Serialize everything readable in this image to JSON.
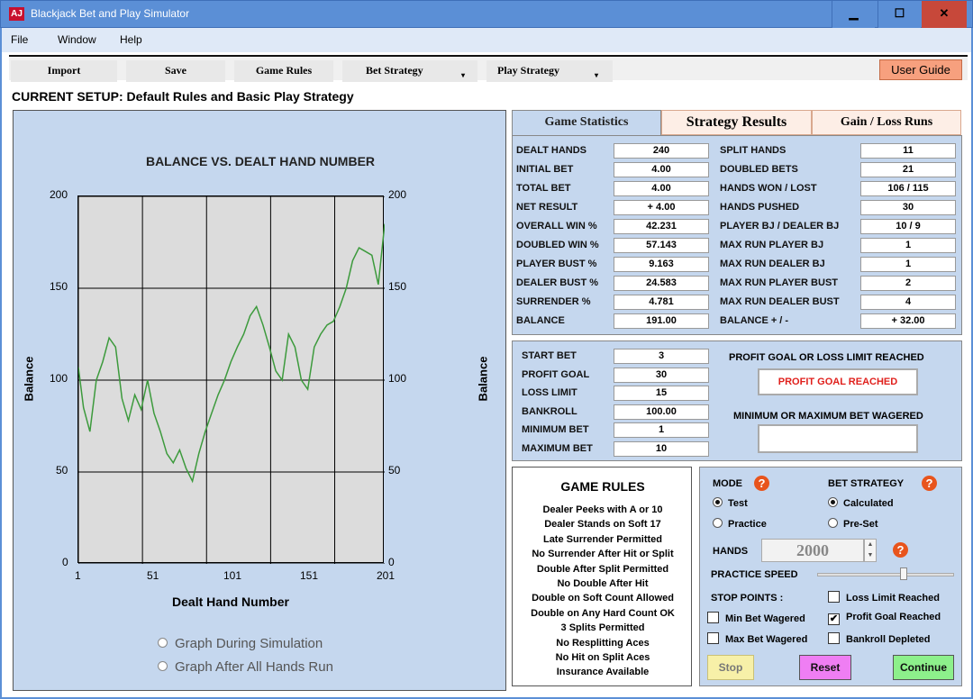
{
  "window": {
    "title": "Blackjack Bet and Play Simulator",
    "icon": "AJ"
  },
  "menu": [
    "File",
    "Window",
    "Help"
  ],
  "toolbar": {
    "import": "Import",
    "save": "Save",
    "game_rules": "Game Rules",
    "bet_strategy": "Bet Strategy",
    "play_strategy": "Play Strategy",
    "user_guide": "User Guide",
    "dropdown_arrow": "▾"
  },
  "setup": {
    "text": "CURRENT SETUP: Default Rules and Basic Play Strategy"
  },
  "chart": {
    "title": "BALANCE VS. DEALT HAND NUMBER",
    "ylabel": "Balance",
    "xlabel": "Dealt Hand Number",
    "yticks": [
      "200",
      "150",
      "100",
      "50",
      "0"
    ],
    "xticks": [
      "1",
      "51",
      "101",
      "151",
      "201"
    ],
    "graph_during": "Graph During Simulation",
    "graph_after": "Graph After All Hands Run"
  },
  "chart_data": {
    "type": "line",
    "title": "BALANCE VS. DEALT HAND NUMBER",
    "xlabel": "Dealt Hand Number",
    "ylabel": "Balance",
    "xlim": [
      1,
      240
    ],
    "ylim": [
      0,
      200
    ],
    "grid": true,
    "line_color": "#3c9a3c",
    "x": [
      1,
      5,
      10,
      15,
      20,
      25,
      30,
      35,
      40,
      45,
      50,
      55,
      60,
      65,
      70,
      75,
      80,
      85,
      90,
      95,
      100,
      105,
      110,
      115,
      120,
      125,
      130,
      135,
      140,
      145,
      150,
      155,
      160,
      165,
      170,
      175,
      180,
      185,
      190,
      195,
      200,
      205,
      210,
      215,
      220,
      225,
      230,
      235,
      240
    ],
    "y": [
      107,
      85,
      72,
      100,
      110,
      123,
      118,
      90,
      78,
      92,
      84,
      100,
      82,
      72,
      60,
      55,
      62,
      52,
      45,
      60,
      72,
      82,
      92,
      100,
      110,
      118,
      125,
      135,
      140,
      130,
      118,
      105,
      100,
      125,
      118,
      100,
      95,
      118,
      125,
      130,
      132,
      140,
      150,
      165,
      172,
      170,
      168,
      152,
      185
    ]
  },
  "tabs": {
    "stats": "Game Statistics",
    "strategy": "Strategy Results",
    "gainloss": "Gain / Loss Runs"
  },
  "stats_left": [
    {
      "label": "DEALT HANDS",
      "value": "240"
    },
    {
      "label": "INITIAL BET",
      "value": "4.00"
    },
    {
      "label": "TOTAL BET",
      "value": "4.00"
    },
    {
      "label": "NET RESULT",
      "value": "+ 4.00"
    },
    {
      "label": "OVERALL WIN %",
      "value": "42.231"
    },
    {
      "label": "DOUBLED WIN %",
      "value": "57.143"
    },
    {
      "label": "PLAYER BUST %",
      "value": "9.163"
    },
    {
      "label": "DEALER BUST %",
      "value": "24.583"
    },
    {
      "label": "SURRENDER  %",
      "value": "4.781"
    },
    {
      "label": "BALANCE",
      "value": "191.00"
    }
  ],
  "stats_right": [
    {
      "label": "SPLIT HANDS",
      "value": "11"
    },
    {
      "label": "DOUBLED BETS",
      "value": "21"
    },
    {
      "label": "HANDS WON / LOST",
      "value": "106 / 115"
    },
    {
      "label": "HANDS PUSHED",
      "value": "30"
    },
    {
      "label": "PLAYER BJ / DEALER BJ",
      "value": "10 / 9"
    },
    {
      "label": "MAX RUN PLAYER BJ",
      "value": "1"
    },
    {
      "label": "MAX RUN DEALER BJ",
      "value": "1"
    },
    {
      "label": "MAX RUN PLAYER BUST",
      "value": "2"
    },
    {
      "label": "MAX RUN DEALER BUST",
      "value": "4"
    },
    {
      "label": "BALANCE  + / -",
      "value": "+ 32.00"
    }
  ],
  "setup_fields": [
    {
      "label": "START BET",
      "value": "3"
    },
    {
      "label": "PROFIT GOAL",
      "value": "30"
    },
    {
      "label": "LOSS LIMIT",
      "value": "15"
    },
    {
      "label": "BANKROLL",
      "value": "100.00"
    },
    {
      "label": "MINIMUM BET",
      "value": "1"
    },
    {
      "label": "MAXIMUM BET",
      "value": "10"
    }
  ],
  "goal": {
    "title": "PROFIT GOAL OR LOSS LIMIT REACHED",
    "status": "PROFIT GOAL REACHED",
    "status_color": "#e0201c",
    "minmax_title": "MINIMUM OR MAXIMUM BET WAGERED",
    "minmax_status": ""
  },
  "rules": {
    "title": "GAME RULES",
    "lines": [
      "Dealer Peeks with A or 10",
      "Dealer Stands on Soft 17",
      "Late Surrender Permitted",
      "No Surrender After Hit or Split",
      "Double After Split Permitted",
      "No Double After Hit",
      "Double on Soft Count Allowed",
      "Double on Any Hard Count OK",
      "3 Splits Permitted",
      "No Resplitting Aces",
      "No Hit on Split Aces",
      "Insurance Available"
    ]
  },
  "mode": {
    "mode_title": "MODE",
    "bet_strategy_title": "BET STRATEGY",
    "test": "Test",
    "practice": "Practice",
    "calculated": "Calculated",
    "preset": "Pre-Set",
    "hands_label": "HANDS",
    "hands_value": "2000",
    "practice_speed": "PRACTICE SPEED",
    "stop_points": "STOP POINTS :",
    "loss_limit": "Loss Limit Reached",
    "min_bet": "Min Bet Wagered",
    "profit_goal": "Profit Goal Reached",
    "max_bet": "Max Bet Wagered",
    "bankroll": "Bankroll Depleted",
    "stop": "Stop",
    "reset": "Reset",
    "continue": "Continue",
    "help": "?",
    "check_mark": "✔",
    "up": "▲",
    "down": "▼"
  }
}
